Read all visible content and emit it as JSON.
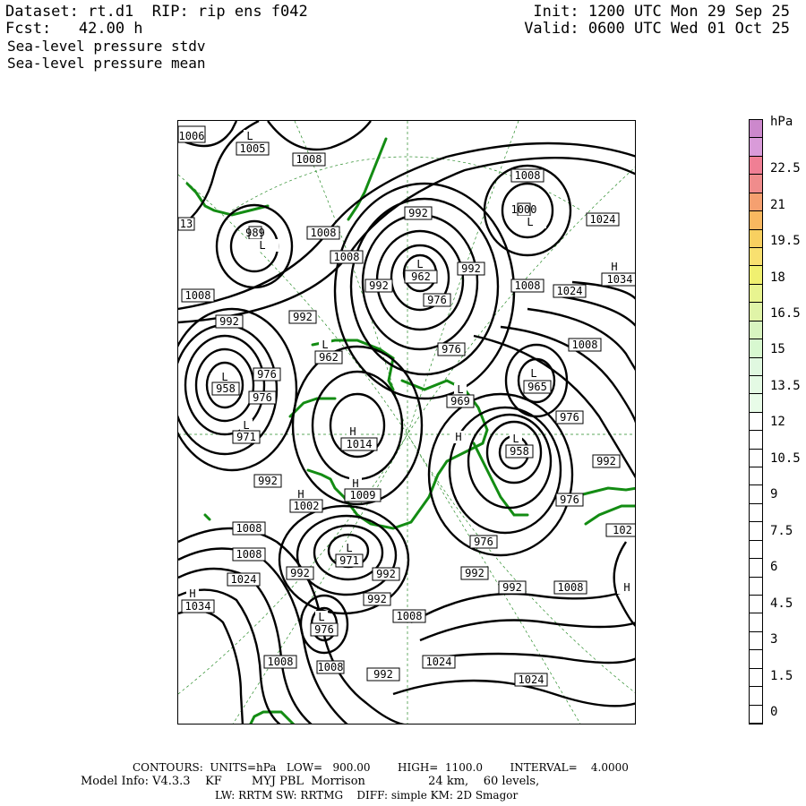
{
  "header": {
    "dataset_line": "Dataset: rt.d1  RIP: rip ens f042",
    "fcst_line": "Fcst:   42.00 h",
    "field1": "Sea-level pressure stdv",
    "field2": "Sea-level pressure mean",
    "init_line": "Init: 1200 UTC Mon 29 Sep 25",
    "valid_line": "Valid: 0600 UTC Wed 01 Oct 25"
  },
  "legend": {
    "unit": "hPa",
    "ticks": [
      "22.5",
      "21",
      "19.5",
      "18",
      "16.5",
      "15",
      "13.5",
      "12",
      "10.5",
      "9",
      "7.5",
      "6",
      "4.5",
      "3",
      "1.5",
      "0"
    ],
    "colors_top_to_bottom": [
      "#cc88cc",
      "#d99bd9",
      "#f07f94",
      "#f08c8c",
      "#f5a070",
      "#f8b860",
      "#f8d060",
      "#f8e070",
      "#f0f070",
      "#e8f490",
      "#e0f4a8",
      "#d8f4c0",
      "#d8f8d0",
      "#e0f8e0",
      "#e4fae4",
      "#e8fce8",
      "#ffffff",
      "#ffffff",
      "#ffffff",
      "#ffffff",
      "#ffffff",
      "#ffffff",
      "#ffffff",
      "#ffffff",
      "#ffffff",
      "#ffffff",
      "#ffffff",
      "#ffffff",
      "#ffffff",
      "#ffffff",
      "#ffffff",
      "#ffffff",
      "#ffffff"
    ]
  },
  "map": {
    "contour_color": "#000000",
    "coast_color": "#138c13",
    "grid_color": "#2a8c2a",
    "labels": [
      "1006",
      "L",
      "1005",
      "1008",
      "1008",
      "992",
      "1000",
      "L",
      "1024",
      "989",
      "L",
      "1008",
      "1008",
      "L",
      "962",
      "992",
      "H",
      "1034",
      "1008",
      "992",
      "1008",
      "1024",
      "976",
      "992",
      "992",
      "976",
      "1008",
      "L",
      "962",
      "L",
      "965",
      "L",
      "958",
      "976",
      "L",
      "969",
      "976",
      "976",
      "L",
      "971",
      "H",
      "1014",
      "H",
      "L",
      "958",
      "992",
      "992",
      "H",
      "1002",
      "H",
      "1009",
      "976",
      "1008",
      "976",
      "1008",
      "L",
      "971",
      "992",
      "992",
      "1024",
      "992",
      "992",
      "1008",
      "H",
      "1034",
      "L",
      "976",
      "992",
      "1008",
      "H",
      "102",
      "1008",
      "992",
      "1008",
      "1024",
      "1024",
      "13"
    ]
  },
  "footer": {
    "line1": "CONTOURS:  UNITS=hPa   LOW=   900.00        HIGH=  1100.0        INTERVAL=    4.0000",
    "line2": "Model Info: V4.3.3    KF        MYJ PBL  Morrison                 24 km,    60 levels,",
    "line3": "LW: RRTM SW: RRTMG    DIFF: simple KM: 2D Smagor"
  }
}
